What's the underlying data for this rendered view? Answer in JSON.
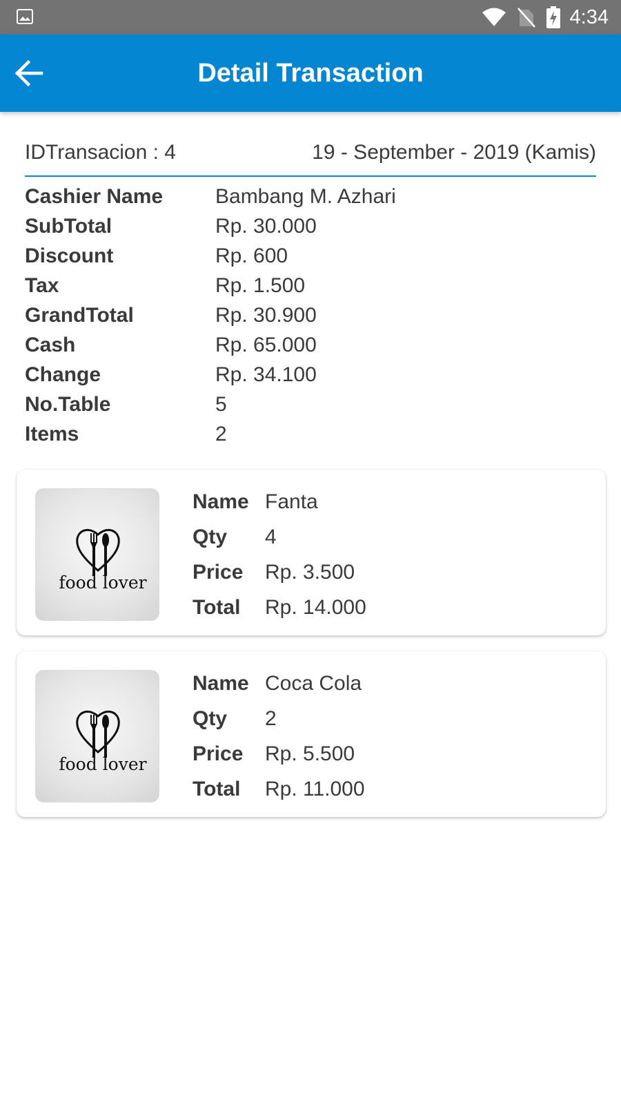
{
  "status_bar": {
    "time": "4:34",
    "icons": [
      "image-icon",
      "wifi-icon",
      "no-sim-icon",
      "battery-charging-icon"
    ]
  },
  "app_bar": {
    "title": "Detail Transaction",
    "back_icon": "arrow-left-icon"
  },
  "colors": {
    "primary": "#0586d2",
    "status_bar": "#737373"
  },
  "summary": {
    "id_text": "IDTransacion : 4",
    "date_text": "19 - September - 2019 (Kamis)"
  },
  "info": [
    {
      "label": "Cashier Name",
      "value": "Bambang M. Azhari"
    },
    {
      "label": "SubTotal",
      "value": "Rp. 30.000"
    },
    {
      "label": "Discount",
      "value": "Rp. 600"
    },
    {
      "label": "Tax",
      "value": "Rp. 1.500"
    },
    {
      "label": "GrandTotal",
      "value": "Rp. 30.900"
    },
    {
      "label": "Cash",
      "value": "Rp. 65.000"
    },
    {
      "label": "Change",
      "value": "Rp. 34.100"
    },
    {
      "label": "No.Table",
      "value": "5"
    },
    {
      "label": "Items",
      "value": "2"
    }
  ],
  "item_labels": {
    "name": "Name",
    "qty": "Qty",
    "price": "Price",
    "total": "Total"
  },
  "items": [
    {
      "name": "Fanta",
      "qty": "4",
      "price": "Rp. 3.500",
      "total": "Rp. 14.000",
      "logo_text": "food lover"
    },
    {
      "name": "Coca Cola",
      "qty": "2",
      "price": "Rp. 5.500",
      "total": "Rp. 11.000",
      "logo_text": "food lover"
    }
  ]
}
